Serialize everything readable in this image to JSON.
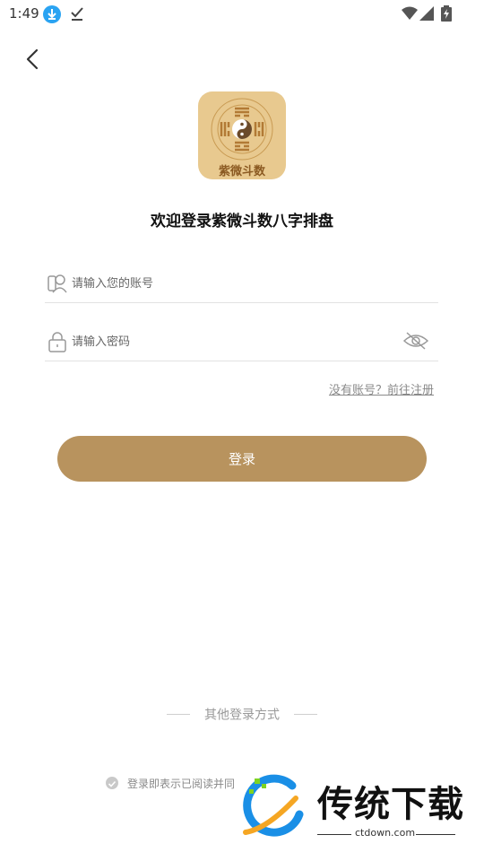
{
  "status_bar": {
    "time": "1:49",
    "icons": [
      "download-icon",
      "check-icon",
      "wifi-icon",
      "signal-icon",
      "battery-icon"
    ]
  },
  "nav": {
    "back_icon": "chevron-left-icon"
  },
  "logo": {
    "text": "紫微斗数"
  },
  "title": "欢迎登录紫微斗数八字排盘",
  "account": {
    "placeholder": "请输入您的账号",
    "value": ""
  },
  "password": {
    "placeholder": "请输入密码",
    "value": ""
  },
  "register_link": "没有账号？前往注册",
  "login_button": "登录",
  "other_login": "其他登录方式",
  "agreement": "登录即表示已阅读并同",
  "watermark": {
    "brand": "传统下载",
    "url": "ctdown.com"
  },
  "colors": {
    "accent": "#b8935e",
    "logo_bg": "#e8c98f",
    "logo_text": "#8b5a22",
    "watermark_blue": "#1a8fe6",
    "watermark_orange": "#f5a623"
  }
}
